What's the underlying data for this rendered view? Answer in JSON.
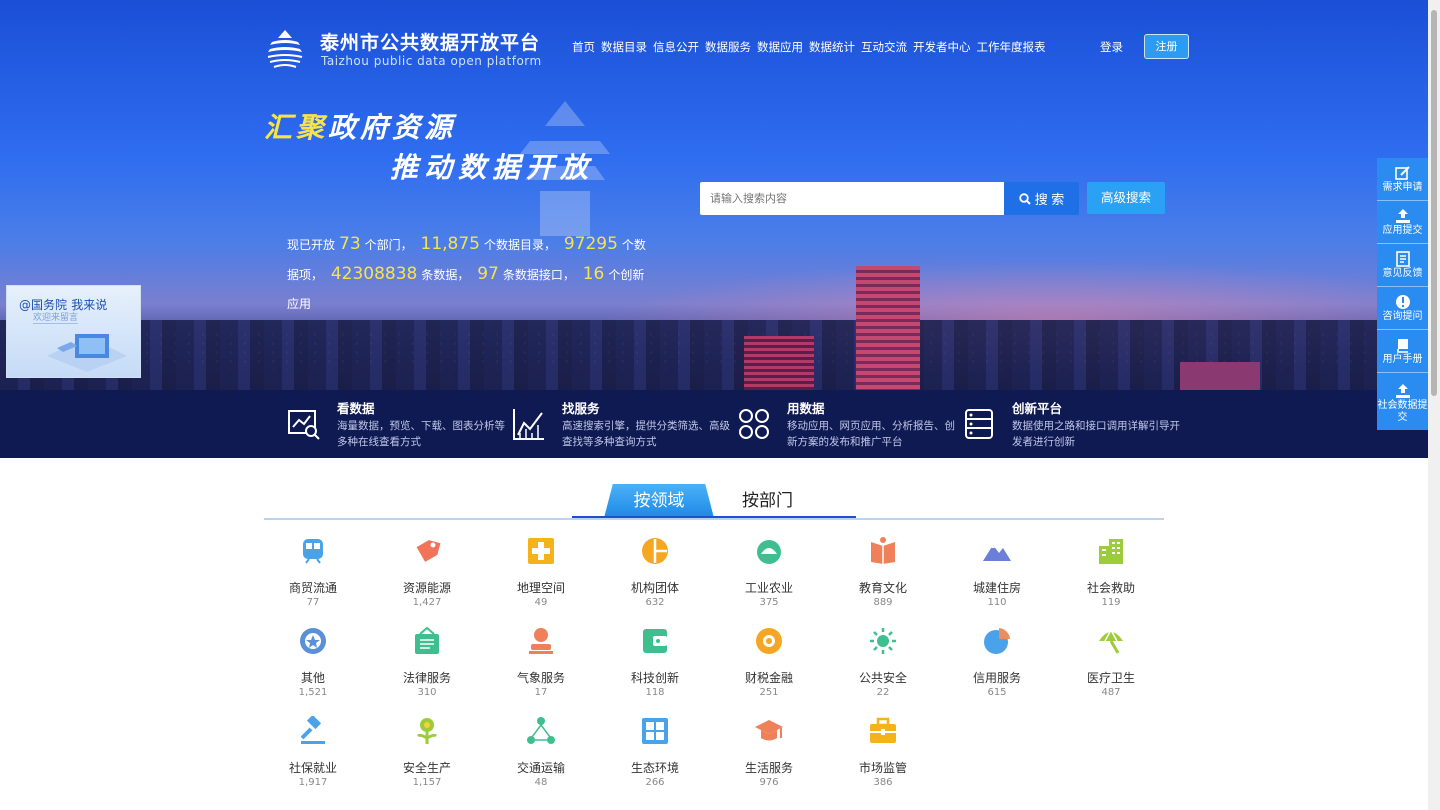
{
  "header": {
    "title": "泰州市公共数据开放平台",
    "subtitle": "Taizhou public data open platform",
    "nav": [
      "首页",
      "数据目录",
      "信息公开",
      "数据服务",
      "数据应用",
      "数据统计",
      "互动交流",
      "开发者中心",
      "工作年度报表"
    ],
    "login": "登录",
    "register": "注册"
  },
  "hero": {
    "slogan1_highlight": "汇聚",
    "slogan1_rest": "政府资源",
    "slogan2": "推动数据开放",
    "stats": {
      "t1": "现已开放",
      "departments": "73",
      "t2": "个部门，",
      "catalogs": "11,875",
      "t3": "个数据目录，",
      "items": "97295",
      "t4": "个数据项，",
      "records": "42308838",
      "t5": "条数据，",
      "apis": "97",
      "t6": "条数据接口，",
      "apps": "16",
      "t7": "个创新应用"
    },
    "search_placeholder": "请输入搜索内容",
    "search_button": "搜 索",
    "advanced_search": "高级搜索"
  },
  "features": [
    {
      "title": "看数据",
      "desc": "海量数据，预览、下载、图表分析等多种在线查看方式",
      "icon": "chart-search-icon"
    },
    {
      "title": "找服务",
      "desc": "高速搜索引擎，提供分类筛选、高级查找等多种查询方式",
      "icon": "line-chart-icon"
    },
    {
      "title": "用数据",
      "desc": "移动应用、网页应用、分析报告、创新方案的发布和推广平台",
      "icon": "apps-icon"
    },
    {
      "title": "创新平台",
      "desc": "数据使用之路和接口调用详解引导开发者进行创新",
      "icon": "database-icon"
    }
  ],
  "side_bar": [
    "需求申请",
    "应用提交",
    "意见反馈",
    "咨询提问",
    "用户手册",
    "社会数据提交"
  ],
  "gov_card": {
    "brand": "@国务院",
    "slogan": "我来说",
    "sub": "欢迎来留言"
  },
  "tabs": {
    "active": "按领域",
    "other": "按部门"
  },
  "categories": [
    {
      "label": "商贸流通",
      "count": "77",
      "color": "#4aa3e8",
      "icon": "train-icon"
    },
    {
      "label": "资源能源",
      "count": "1,427",
      "color": "#f0735a",
      "icon": "tag-icon"
    },
    {
      "label": "地理空间",
      "count": "49",
      "color": "#f5b21b",
      "icon": "plus-box-icon"
    },
    {
      "label": "机构团体",
      "count": "632",
      "color": "#f5a623",
      "icon": "pie-circle-icon"
    },
    {
      "label": "工业农业",
      "count": "375",
      "color": "#3fbf8f",
      "icon": "drop-icon"
    },
    {
      "label": "教育文化",
      "count": "889",
      "color": "#f0805a",
      "icon": "book-icon"
    },
    {
      "label": "城建住房",
      "count": "110",
      "color": "#6b7fd8",
      "icon": "mountain-icon"
    },
    {
      "label": "社会救助",
      "count": "119",
      "color": "#9ccc3a",
      "icon": "building-icon"
    },
    {
      "label": "其他",
      "count": "1,521",
      "color": "#5b8fd8",
      "icon": "badge-icon"
    },
    {
      "label": "法律服务",
      "count": "310",
      "color": "#3fbf8f",
      "icon": "wallet-icon"
    },
    {
      "label": "气象服务",
      "count": "17",
      "color": "#f0805a",
      "icon": "person-icon"
    },
    {
      "label": "科技创新",
      "count": "118",
      "color": "#3fbf8f",
      "icon": "purse-icon"
    },
    {
      "label": "财税金融",
      "count": "251",
      "color": "#f5a623",
      "icon": "lifebuoy-icon"
    },
    {
      "label": "公共安全",
      "count": "22",
      "color": "#3fbf8f",
      "icon": "sun-icon"
    },
    {
      "label": "信用服务",
      "count": "615",
      "color": "#4aa3e8",
      "icon": "pie-chart-icon"
    },
    {
      "label": "医疗卫生",
      "count": "487",
      "color": "#9ccc3a",
      "icon": "umbrella-icon"
    },
    {
      "label": "社保就业",
      "count": "1,917",
      "color": "#4aa3e8",
      "icon": "gavel-icon"
    },
    {
      "label": "安全生产",
      "count": "1,157",
      "color": "#9ccc3a",
      "icon": "flower-icon"
    },
    {
      "label": "交通运输",
      "count": "48",
      "color": "#3fbf8f",
      "icon": "network-icon"
    },
    {
      "label": "生态环境",
      "count": "266",
      "color": "#4aa3e8",
      "icon": "grid-box-icon"
    },
    {
      "label": "生活服务",
      "count": "976",
      "color": "#f0805a",
      "icon": "graduation-cap-icon"
    },
    {
      "label": "市场监管",
      "count": "386",
      "color": "#f5b21b",
      "icon": "briefcase-icon"
    }
  ]
}
